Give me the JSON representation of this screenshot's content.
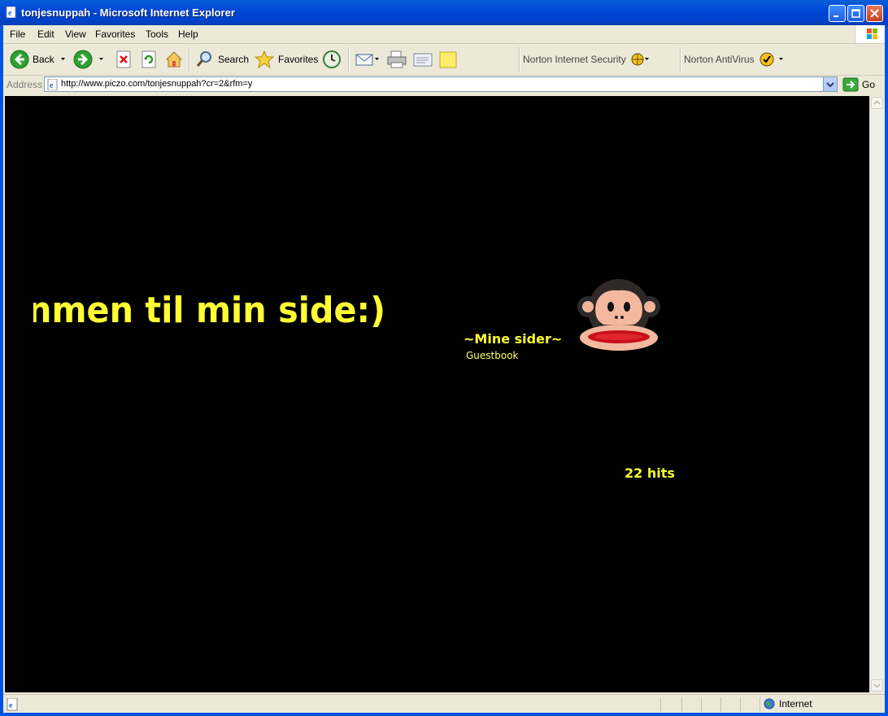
{
  "window": {
    "title": "tonjesnuppah - Microsoft Internet Explorer"
  },
  "menubar": {
    "items": [
      {
        "label": "File"
      },
      {
        "label": "Edit"
      },
      {
        "label": "View"
      },
      {
        "label": "Favorites"
      },
      {
        "label": "Tools"
      },
      {
        "label": "Help"
      }
    ]
  },
  "toolbar": {
    "back_label": "Back",
    "search_label": "Search",
    "favorites_label": "Favorites",
    "norton_security_label": "Norton Internet Security",
    "norton_antivirus_label": "Norton AntiVirus"
  },
  "addressbar": {
    "label": "Address",
    "url": "http://www.piczo.com/tonjesnuppah?cr=2&rfm=y",
    "go_label": "Go"
  },
  "page": {
    "heading": "nmen til min side:)",
    "nav_title": "~Mine sider~",
    "nav_links": [
      {
        "label": "Guestbook"
      }
    ],
    "hits": "22 hits"
  },
  "statusbar": {
    "text": "",
    "zone": "Internet"
  },
  "colors": {
    "page_bg": "#000000",
    "page_text": "#ffff33",
    "chrome_bg": "#ece9d8",
    "titlebar": "#0054e3"
  }
}
